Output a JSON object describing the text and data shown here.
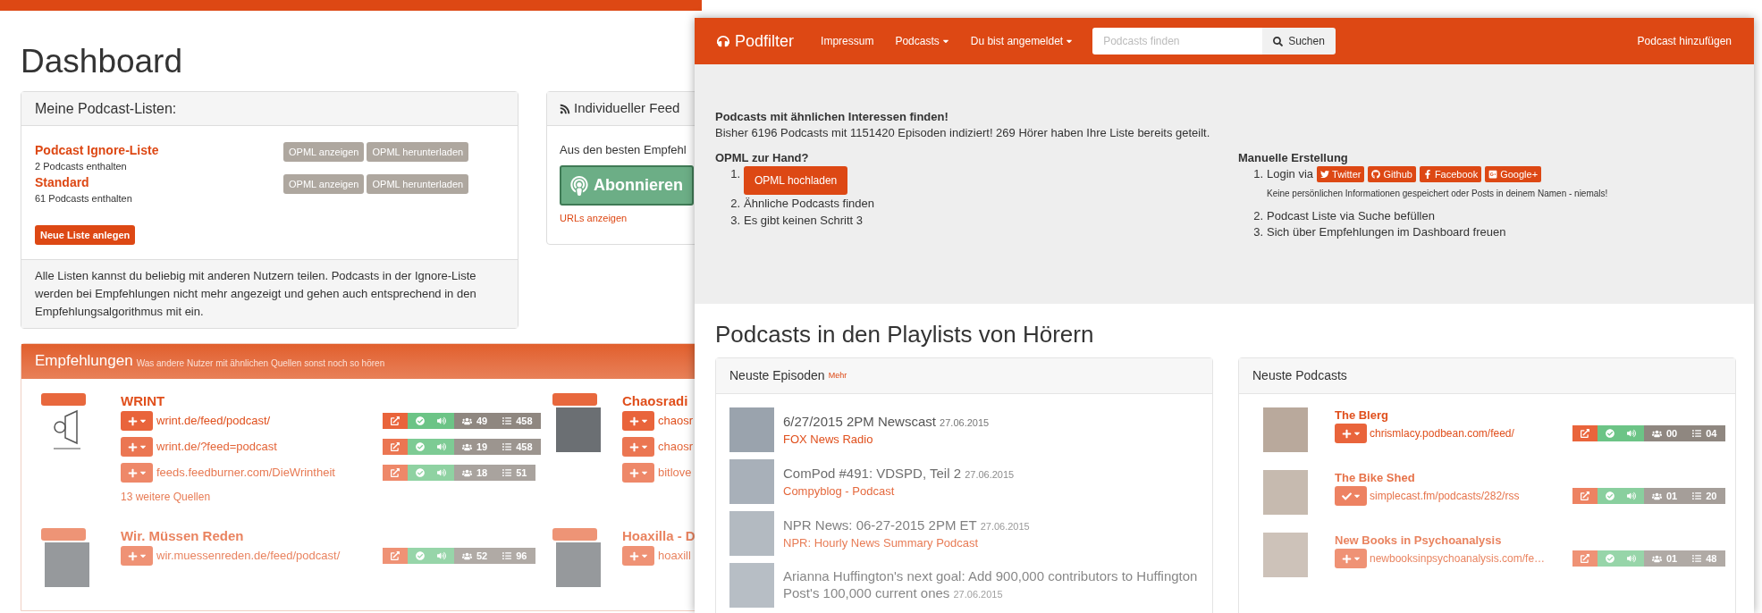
{
  "back_window": {
    "title": "Dashboard",
    "lists_panel": {
      "heading": "Meine Podcast-Listen:",
      "lists": [
        {
          "name": "Podcast Ignore-Liste",
          "count": "2 Podcasts enthalten",
          "buttons": [
            "OPML anzeigen",
            "OPML herunterladen"
          ]
        },
        {
          "name": "Standard",
          "count": "61 Podcasts enthalten",
          "buttons": [
            "OPML anzeigen",
            "OPML herunterladen"
          ]
        }
      ],
      "new_button": "Neue Liste anlegen",
      "footer": "Alle Listen kannst du beliebig mit anderen Nutzern teilen. Podcasts in der Ignore-Liste werden bei Empfehlungen nicht mehr angezeigt und gehen auch entsprechend in den Empfehlungsalgorithmus mit ein."
    },
    "feed_panel": {
      "heading": "Individueller Feed",
      "text": "Aus den besten Empfehl",
      "subscribe_button": "Abonnieren",
      "link": "URLs anzeigen"
    },
    "recommendations": {
      "heading": "Empfehlungen",
      "subheading": "Was andere Nutzer mit ähnlichen Quellen sonst noch so hören",
      "podcasts": [
        {
          "title": "WRINT",
          "kind": "logo",
          "feeds": [
            {
              "url": "wrint.de/feed/podcast/",
              "listeners": "49",
              "episodes": "458"
            },
            {
              "url": "wrint.de/?feed=podcast",
              "listeners": "19",
              "episodes": "458"
            },
            {
              "url": "feeds.feedburner.com/DieWrintheit",
              "listeners": "18",
              "episodes": "51"
            }
          ],
          "more": "13 weitere Quellen"
        },
        {
          "title": "Chaosradi",
          "kind": "photo",
          "feeds": [
            {
              "url": "chaosr"
            },
            {
              "url": "chaosr"
            },
            {
              "url": "bitlove"
            }
          ]
        },
        {
          "title": "Wir. Müssen Reden",
          "kind": "photo",
          "feeds": [
            {
              "url": "wir.muessenreden.de/feed/podcast/",
              "listeners": "52",
              "episodes": "96"
            }
          ]
        },
        {
          "title": "Hoaxilla - D",
          "kind": "photo",
          "feeds": [
            {
              "url": "hoaxill"
            }
          ]
        }
      ]
    }
  },
  "front_window": {
    "nav": {
      "brand": "Podfilter",
      "links": [
        {
          "label": "Impressum",
          "dropdown": false
        },
        {
          "label": "Podcasts",
          "dropdown": true
        },
        {
          "label": "Du bist angemeldet",
          "dropdown": true
        }
      ],
      "search": {
        "placeholder": "Podcasts finden",
        "button": "Suchen"
      },
      "add_link": "Podcast hinzufügen"
    },
    "hero": {
      "title": "Podcasts mit ähnlichen Interessen finden!",
      "stats": "Bisher 6196 Podcasts mit 1151420 Episoden indiziert! 269 Hörer haben Ihre Liste bereits geteilt.",
      "opml": {
        "heading": "OPML zur Hand?",
        "steps": [
          {
            "number": "1.",
            "kind": "button",
            "label": "OPML hochladen"
          },
          {
            "number": "2.",
            "kind": "text",
            "label": "Ähnliche Podcasts finden"
          },
          {
            "number": "3.",
            "kind": "text",
            "label": "Es gibt keinen Schritt 3"
          }
        ]
      },
      "manual": {
        "heading": "Manuelle Erstellung",
        "steps": [
          {
            "number": "1.",
            "kind": "login",
            "label": "Login via",
            "providers": [
              {
                "kind": "twitter",
                "label": "Twitter"
              },
              {
                "kind": "github",
                "label": "Github"
              },
              {
                "kind": "facebook",
                "label": "Facebook"
              },
              {
                "kind": "google",
                "label": "Google+"
              }
            ],
            "note": "Keine persönlichen Informationen gespeichert oder Posts in deinem Namen - niemals!"
          },
          {
            "number": "2.",
            "kind": "text",
            "label": "Podcast Liste via Suche befüllen"
          },
          {
            "number": "3.",
            "kind": "text",
            "label": "Sich über Empfehlungen im Dashboard freuen"
          }
        ]
      }
    },
    "playlists": {
      "title": "Podcasts in den Playlists von Hörern",
      "episodes": {
        "heading": "Neuste Episoden",
        "more": "Mehr",
        "items": [
          {
            "title": "6/27/2015 2PM Newscast",
            "date": "27.06.2015",
            "podcast": "FOX News Radio"
          },
          {
            "title": "ComPod #491: VDSPD, Teil 2",
            "date": "27.06.2015",
            "podcast": "Compyblog - Podcast"
          },
          {
            "title": "NPR News: 06-27-2015 2PM ET",
            "date": "27.06.2015",
            "podcast": "NPR: Hourly News Summary Podcast"
          },
          {
            "title": "Arianna Huffington's next goal: Add 900,000 contributors to Huffington Post's 100,000 current ones",
            "date": "27.06.2015"
          }
        ]
      },
      "podcasts": {
        "heading": "Neuste Podcasts",
        "items": [
          {
            "title": "The Blerg",
            "url": "chrismlacy.podbean.com/feed/",
            "subscribed": false,
            "listeners": "00",
            "episodes": "04"
          },
          {
            "title": "The Bike Shed",
            "url": "simplecast.fm/podcasts/282/rss",
            "subscribed": true,
            "listeners": "01",
            "episodes": "20"
          },
          {
            "title": "New Books in Psychoanalysis",
            "url": "newbooksinpsychoanalysis.com/fe…",
            "subscribed": false,
            "listeners": "01",
            "episodes": "48"
          }
        ]
      }
    }
  }
}
